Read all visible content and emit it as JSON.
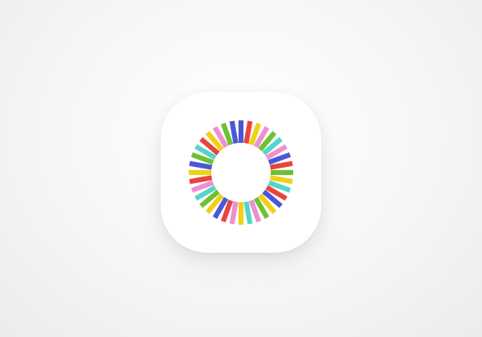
{
  "icon": {
    "name": "radial-color-burst-icon",
    "background": "#ffffff"
  },
  "rays": {
    "count": 36,
    "colors": [
      "#4a57d6",
      "#e8453c",
      "#f2d018",
      "#ee8fd0",
      "#6dc132",
      "#55d5c9",
      "#ee8fd0",
      "#4a57d6",
      "#e8453c",
      "#6dc132",
      "#f2d018",
      "#55d5c9",
      "#e8453c",
      "#4a57d6",
      "#f2d018",
      "#6dc132",
      "#ee8fd0",
      "#55d5c9",
      "#f2d018",
      "#ee8fd0",
      "#e8453c",
      "#4a57d6",
      "#f2d018",
      "#6dc132",
      "#55d5c9",
      "#ee8fd0",
      "#e8453c",
      "#f2d018",
      "#4a57d6",
      "#6dc132",
      "#55d5c9",
      "#e8453c",
      "#f2d018",
      "#ee8fd0",
      "#6dc132",
      "#4a57d6"
    ]
  }
}
